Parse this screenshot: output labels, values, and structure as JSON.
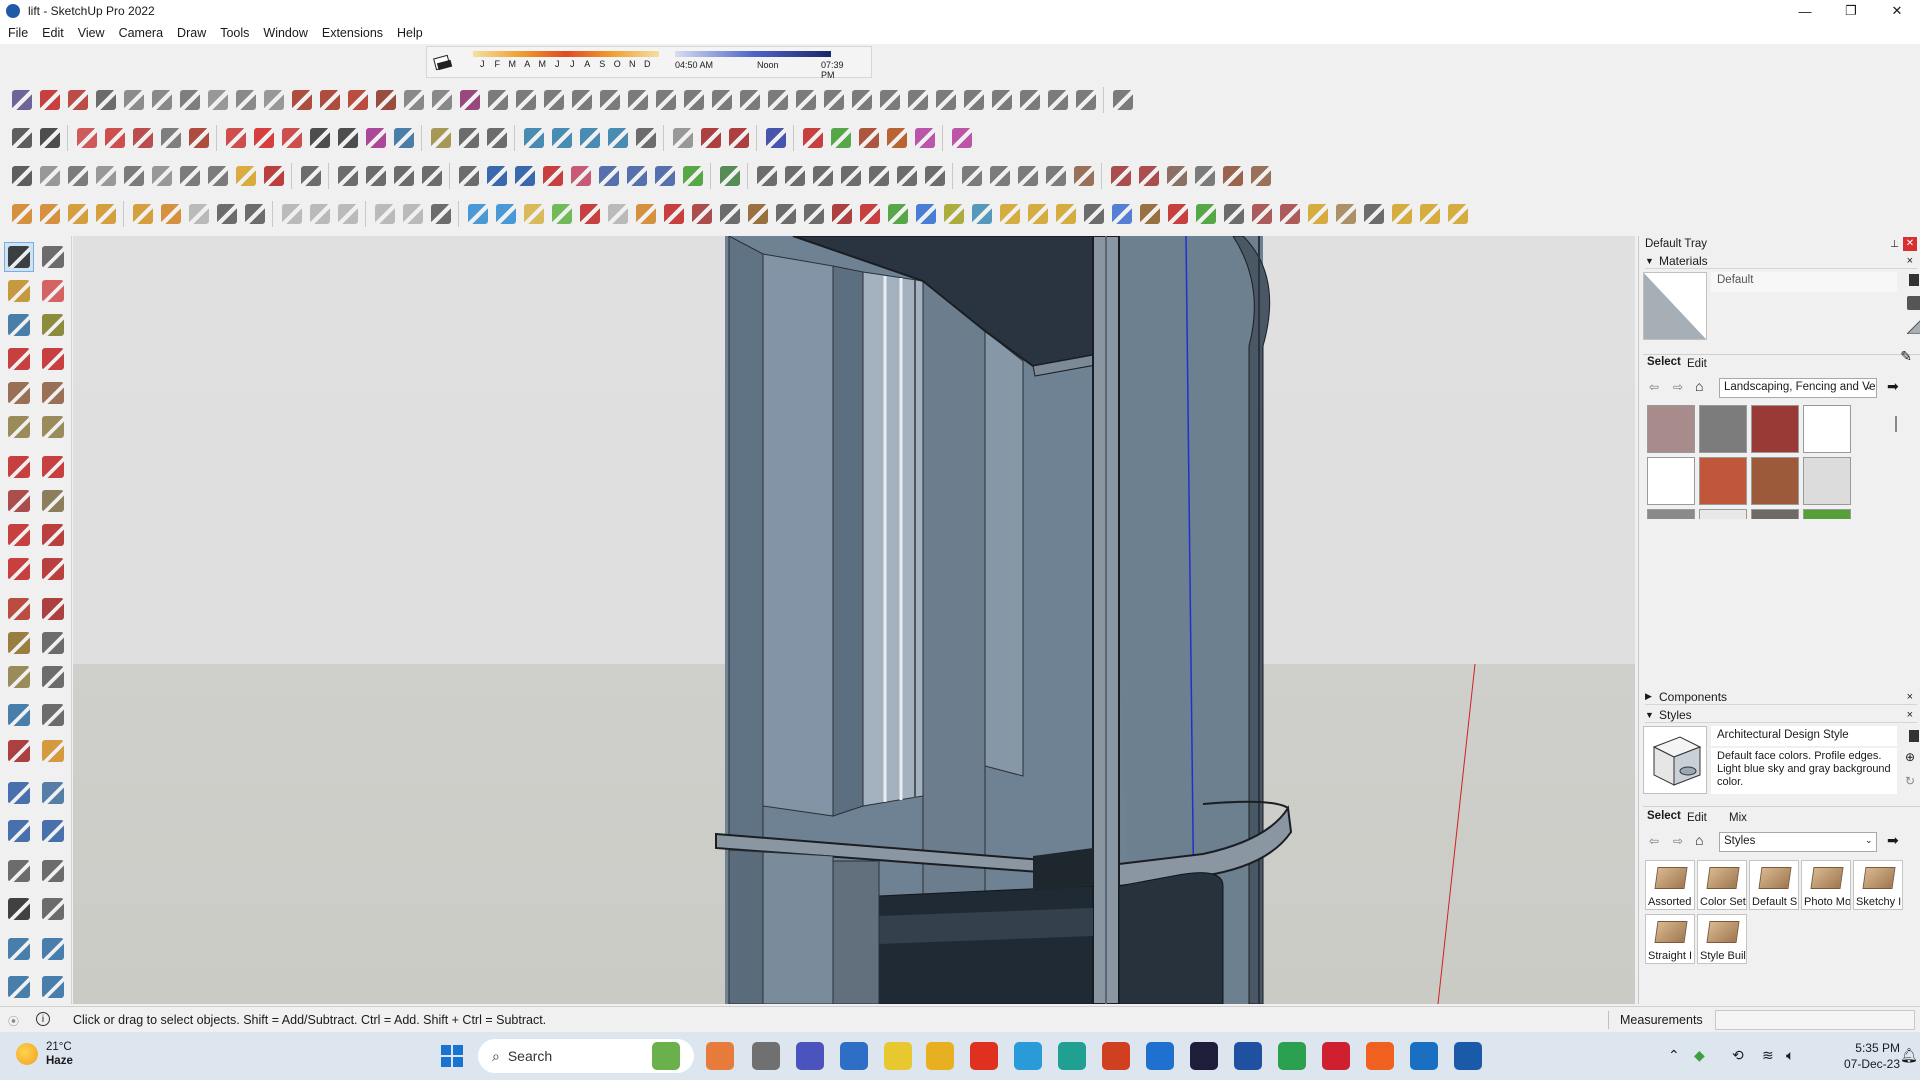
{
  "window": {
    "title": "lift - SketchUp Pro 2022",
    "minimize": "—",
    "maximize": "❐",
    "close": "✕"
  },
  "menu": [
    "File",
    "Edit",
    "View",
    "Camera",
    "Draw",
    "Tools",
    "Window",
    "Extensions",
    "Help"
  ],
  "shadow": {
    "months": [
      "J",
      "F",
      "M",
      "A",
      "M",
      "J",
      "J",
      "A",
      "S",
      "O",
      "N",
      "D"
    ],
    "sunrise": "04:50 AM",
    "noon": "Noon",
    "sunset": "07:39 PM"
  },
  "tray": {
    "title": "Default Tray",
    "materials": {
      "header": "Materials",
      "current": "Default",
      "tab_select": "Select",
      "tab_edit": "Edit",
      "collection": "Landscaping, Fencing and Ve",
      "swatch_colors": [
        "#a88c8c",
        "#7c7c7c",
        "#9a3a36",
        "#ffffff",
        "#ffffff",
        "#c0563a",
        "#9c5a3a",
        "#dcdcdc",
        "#8a8a8a",
        "#e8e8e8",
        "#706a66",
        "#56a03a",
        "#8fae3e",
        "#7e7e80",
        "#a04a44",
        "#a88c70",
        "#9c5c54",
        "#8a7050",
        "#7e7e80",
        "#9a8a90"
      ]
    },
    "components": {
      "header": "Components"
    },
    "styles": {
      "header": "Styles",
      "name": "Architectural Design Style",
      "description": "Default face colors. Profile edges. Light blue sky and gray background color.",
      "tab_select": "Select",
      "tab_edit": "Edit",
      "tab_mix": "Mix",
      "collection": "Styles",
      "items": [
        "Assorted",
        "Color Set",
        "Default S",
        "Photo Mo",
        "Sketchy I",
        "Straight I",
        "Style Buil"
      ]
    }
  },
  "status": {
    "message": "Click or drag to select objects. Shift = Add/Subtract. Ctrl = Add. Shift + Ctrl = Subtract.",
    "measurements_label": "Measurements",
    "measurements_value": ""
  },
  "taskbar": {
    "temperature": "21°C",
    "condition": "Haze",
    "search": "Search",
    "time": "5:35 PM",
    "date": "07-Dec-23"
  },
  "icons": {
    "row1_colors": [
      "#5a4a8a",
      "#c02020",
      "#b0302a",
      "#555",
      "#7a7a7a",
      "#777",
      "#6a6a6a",
      "#888",
      "#777",
      "#888",
      "#a03020",
      "#a03020",
      "#b03020",
      "#8a3020",
      "#777",
      "#777",
      "#8a2a6a",
      "#666",
      "#666",
      "#666",
      "#666",
      "#666",
      "#666",
      "#666",
      "#666",
      "#666",
      "#666",
      "#666",
      "#666",
      "#666",
      "#666",
      "#666",
      "#666",
      "#666",
      "#666",
      "#666",
      "#666",
      "#666",
      "#666",
      "#666",
      "#666"
    ],
    "row2_colors": [
      "#444",
      "#303030",
      "#c84040",
      "#c83030",
      "#b03030",
      "#6a6a6a",
      "#a03020",
      "#c83030",
      "#d02020",
      "#c83030",
      "#303030",
      "#303030",
      "#a02a8a",
      "#2a6a9a",
      "#9a8a3a",
      "#555",
      "#555",
      "#2a7aa8",
      "#2a7aa8",
      "#2a7aa8",
      "#2a7aa8",
      "#555",
      "#888",
      "#a02020",
      "#a02020",
      "#2a3aa0",
      "#c02020",
      "#3a9a2a",
      "#a03a20",
      "#b04a10",
      "#b03aa0",
      "#b03a9a"
    ],
    "row3_colors": [
      "#444",
      "#888",
      "#666",
      "#888",
      "#666",
      "#888",
      "#666",
      "#666",
      "#d4a020",
      "#b02020",
      "#555",
      "#555",
      "#555",
      "#555",
      "#555",
      "#555",
      "#1a50a0",
      "#1a50a0",
      "#c02020",
      "#c04060",
      "#3a5aa0",
      "#3a5aa0",
      "#3a5aa0",
      "#3a9a2a",
      "#3a7a3a",
      "#555",
      "#555",
      "#555",
      "#555",
      "#555",
      "#555",
      "#555",
      "#666",
      "#666",
      "#666",
      "#666",
      "#8a5a40",
      "#a03030",
      "#a03030",
      "#7a5a4a",
      "#666",
      "#8a4a30",
      "#8a5a40"
    ],
    "row4_colors": [
      "#d08020",
      "#d08020",
      "#d09020",
      "#d09020",
      "#d09020",
      "#d08020",
      "#b0b0b0",
      "#555",
      "#555",
      "#b0b0b0",
      "#b0b0b0",
      "#b0b0b0",
      "#b0b0b0",
      "#b0b0b0",
      "#555",
      "#2a8ad0",
      "#2a8ad0",
      "#d4b040",
      "#5ab040",
      "#c02020",
      "#b0b0b0",
      "#d08020",
      "#c02020",
      "#a03030",
      "#555",
      "#8a5a20",
      "#555",
      "#555",
      "#a02020",
      "#c02020",
      "#3a9a2a",
      "#2a6ad0",
      "#a0a020",
      "#3a8ab0",
      "#d0a020",
      "#d0a020",
      "#d0a020",
      "#555",
      "#3a6ad0",
      "#8a5a20",
      "#c02020",
      "#3a9a2a",
      "#555",
      "#a04040",
      "#a04040",
      "#d0a020",
      "#a08050",
      "#555",
      "#d0a020",
      "#d0a020",
      "#d0a020",
      "#c02020",
      "#555"
    ],
    "left_colors": [
      "#222",
      "#555",
      "#c08a20",
      "#d04a4a",
      "#2a6a9a",
      "#7a7a20",
      "#c02020",
      "#c02020",
      "#8a5a3a",
      "#8a5a3a",
      "#8a7a40",
      "#8a7a40",
      "#c02020",
      "#c02020",
      "#a03030",
      "#7a6a40",
      "#c02020",
      "#b02020",
      "#c02020",
      "#b02020",
      "#b03020",
      "#a02020",
      "#8a6a20",
      "#555",
      "#8a7a40",
      "#555",
      "#2a6aa0",
      "#555",
      "#a02020",
      "#d08a20",
      "#2a5aa0",
      "#3a6a9a",
      "#2a5aa0",
      "#2a5aa0",
      "#555",
      "#555",
      "#222",
      "#555",
      "#2a6aa0",
      "#2a6aa0",
      "#2a6aa0",
      "#2a6aa0"
    ]
  }
}
